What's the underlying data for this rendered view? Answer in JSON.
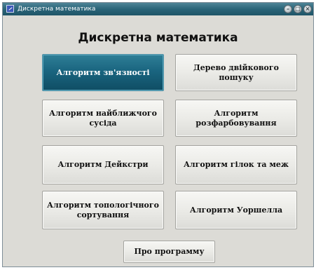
{
  "window": {
    "title": "Дискретна математика"
  },
  "heading": "Дискретна математика",
  "buttons": [
    {
      "label": "Алгоритм зв'язності"
    },
    {
      "label": "Дерево  двійкового пошуку"
    },
    {
      "label": "Алгоритм найближчого сусіда"
    },
    {
      "label": "Алгоритм розфарбовування"
    },
    {
      "label": "Алгоритм Дейкстри"
    },
    {
      "label": "Алгоритм гілок та меж"
    },
    {
      "label": "Алгоритм топологічного сортування"
    },
    {
      "label": "Алгоритм Уоршелла"
    }
  ],
  "about_button": "Про программу",
  "selected_button": "Алгоритм зв'язності",
  "colors": {
    "titlebar": "#2a6478",
    "window_bg": "#dcdbd6",
    "active_button": "#1a6580",
    "button_face": "#ebebe7"
  },
  "icons": [
    "app-icon",
    "minimize-icon",
    "maximize-icon",
    "close-icon"
  ]
}
